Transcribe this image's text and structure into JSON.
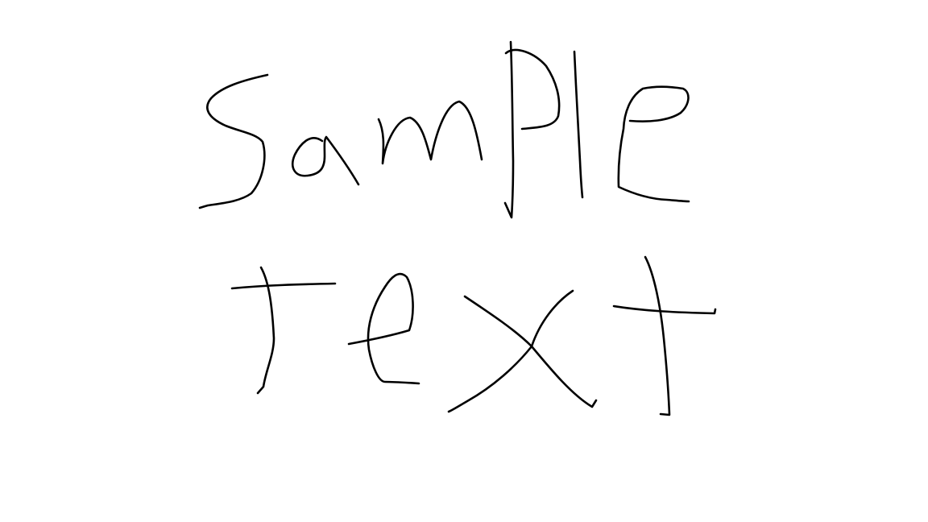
{
  "canvas": {
    "background": "#ffffff",
    "ink_color": "#000000"
  },
  "handwriting": {
    "lines": [
      "Sample",
      "text"
    ]
  }
}
